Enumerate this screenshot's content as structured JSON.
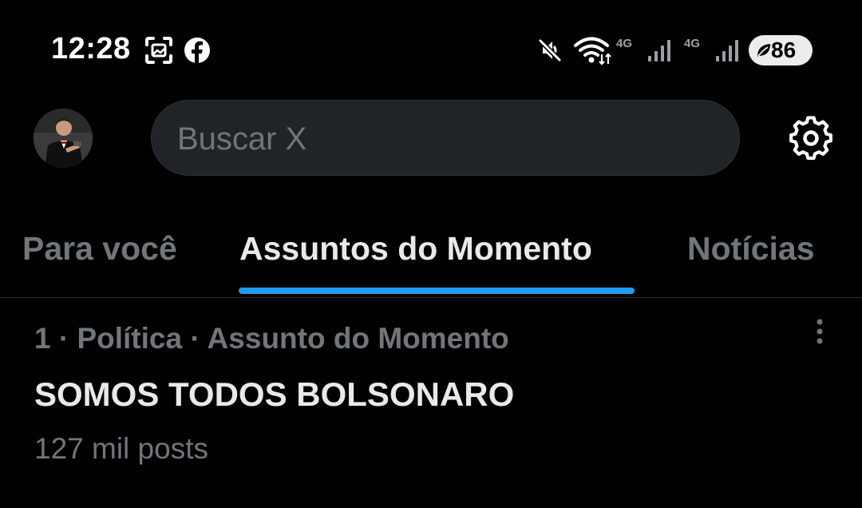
{
  "status_bar": {
    "time": "12:28",
    "net_1": "4G",
    "net_2": "4G",
    "battery": "86",
    "icons": [
      "screenshot-icon",
      "facebook-icon",
      "mute-icon",
      "wifi-icon",
      "signal-icon",
      "battery-leaf-icon"
    ]
  },
  "header": {
    "search_placeholder": "Buscar X",
    "icons": [
      "avatar",
      "gear-icon"
    ]
  },
  "tabs": [
    {
      "label": "Para você",
      "active": false
    },
    {
      "label": "Assuntos do Momento",
      "active": true
    },
    {
      "label": "Notícias",
      "active": false
    }
  ],
  "trends": [
    {
      "meta": "1 · Política · Assunto do Momento",
      "title": "SOMOS TODOS BOLSONARO",
      "count": "127 mil posts"
    }
  ],
  "colors": {
    "background": "#000000",
    "accent": "#1d9bf0",
    "text_primary": "#e7e9ea",
    "text_secondary": "#71767b",
    "search_bg": "#202327"
  }
}
